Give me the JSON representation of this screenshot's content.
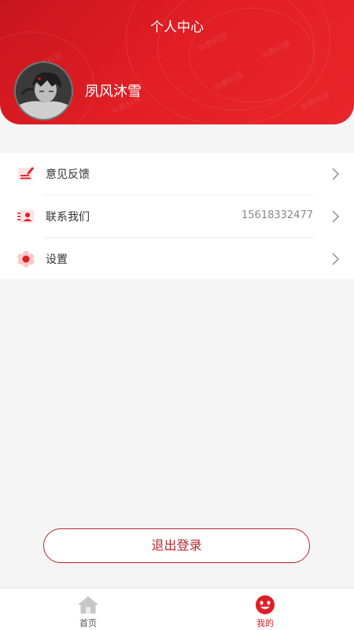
{
  "header": {
    "title": "个人中心",
    "username": "夙风沐雪",
    "watermark": "中鼎科技",
    "accent_color": "#e01e24"
  },
  "menu": {
    "items": [
      {
        "label": "意见反馈",
        "icon": "feedback-icon"
      },
      {
        "label": "联系我们",
        "value": "15618332477",
        "icon": "contact-card-icon"
      },
      {
        "label": "设置",
        "icon": "settings-flower-icon"
      }
    ],
    "chevron_icon": "chevron-right-icon"
  },
  "logout": {
    "label": "退出登录",
    "border_color": "#b3282d"
  },
  "tabbar": {
    "tabs": [
      {
        "label": "首页",
        "icon": "home-icon",
        "active": false,
        "color": "#555555"
      },
      {
        "label": "我的",
        "icon": "smiley-icon",
        "active": true,
        "color": "#e01e24"
      }
    ]
  }
}
